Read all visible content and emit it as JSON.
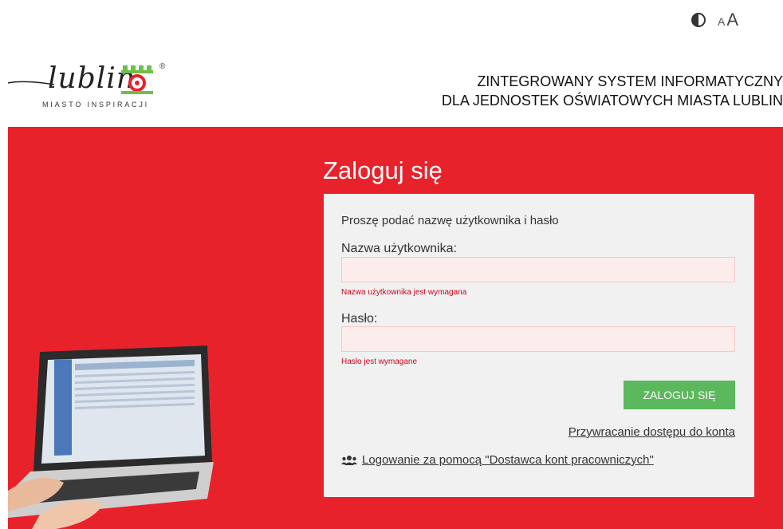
{
  "accessibility": {
    "contrast_icon": "contrast-icon",
    "font_small": "A",
    "font_large": "A"
  },
  "logo": {
    "word": "lublin",
    "tagline": "MIASTO INSPIRACJI",
    "registered": "®"
  },
  "header": {
    "title_line1": "ZINTEGROWANY SYSTEM INFORMATYCZNY",
    "title_line2": "DLA JEDNOSTEK OŚWIATOWYCH MIASTA LUBLIN"
  },
  "login": {
    "heading": "Zaloguj się",
    "lead": "Proszę podać nazwę użytkownika i hasło",
    "username_label": "Nazwa użytkownika:",
    "username_value": "",
    "username_error": "Nazwa użytkownika jest wymagana",
    "password_label": "Hasło:",
    "password_value": "",
    "password_error": "Hasło jest wymagane",
    "submit_label": "ZALOGUJ SIĘ",
    "recover_link": "Przywracanie dostępu do konta",
    "provider_icon": "users-icon",
    "provider_link": "Logowanie za pomocą \"Dostawca kont pracowniczych\""
  },
  "colors": {
    "band": "#e8222b",
    "submit": "#5cb85c",
    "error": "#d0021b",
    "card": "#f1f1f1"
  }
}
